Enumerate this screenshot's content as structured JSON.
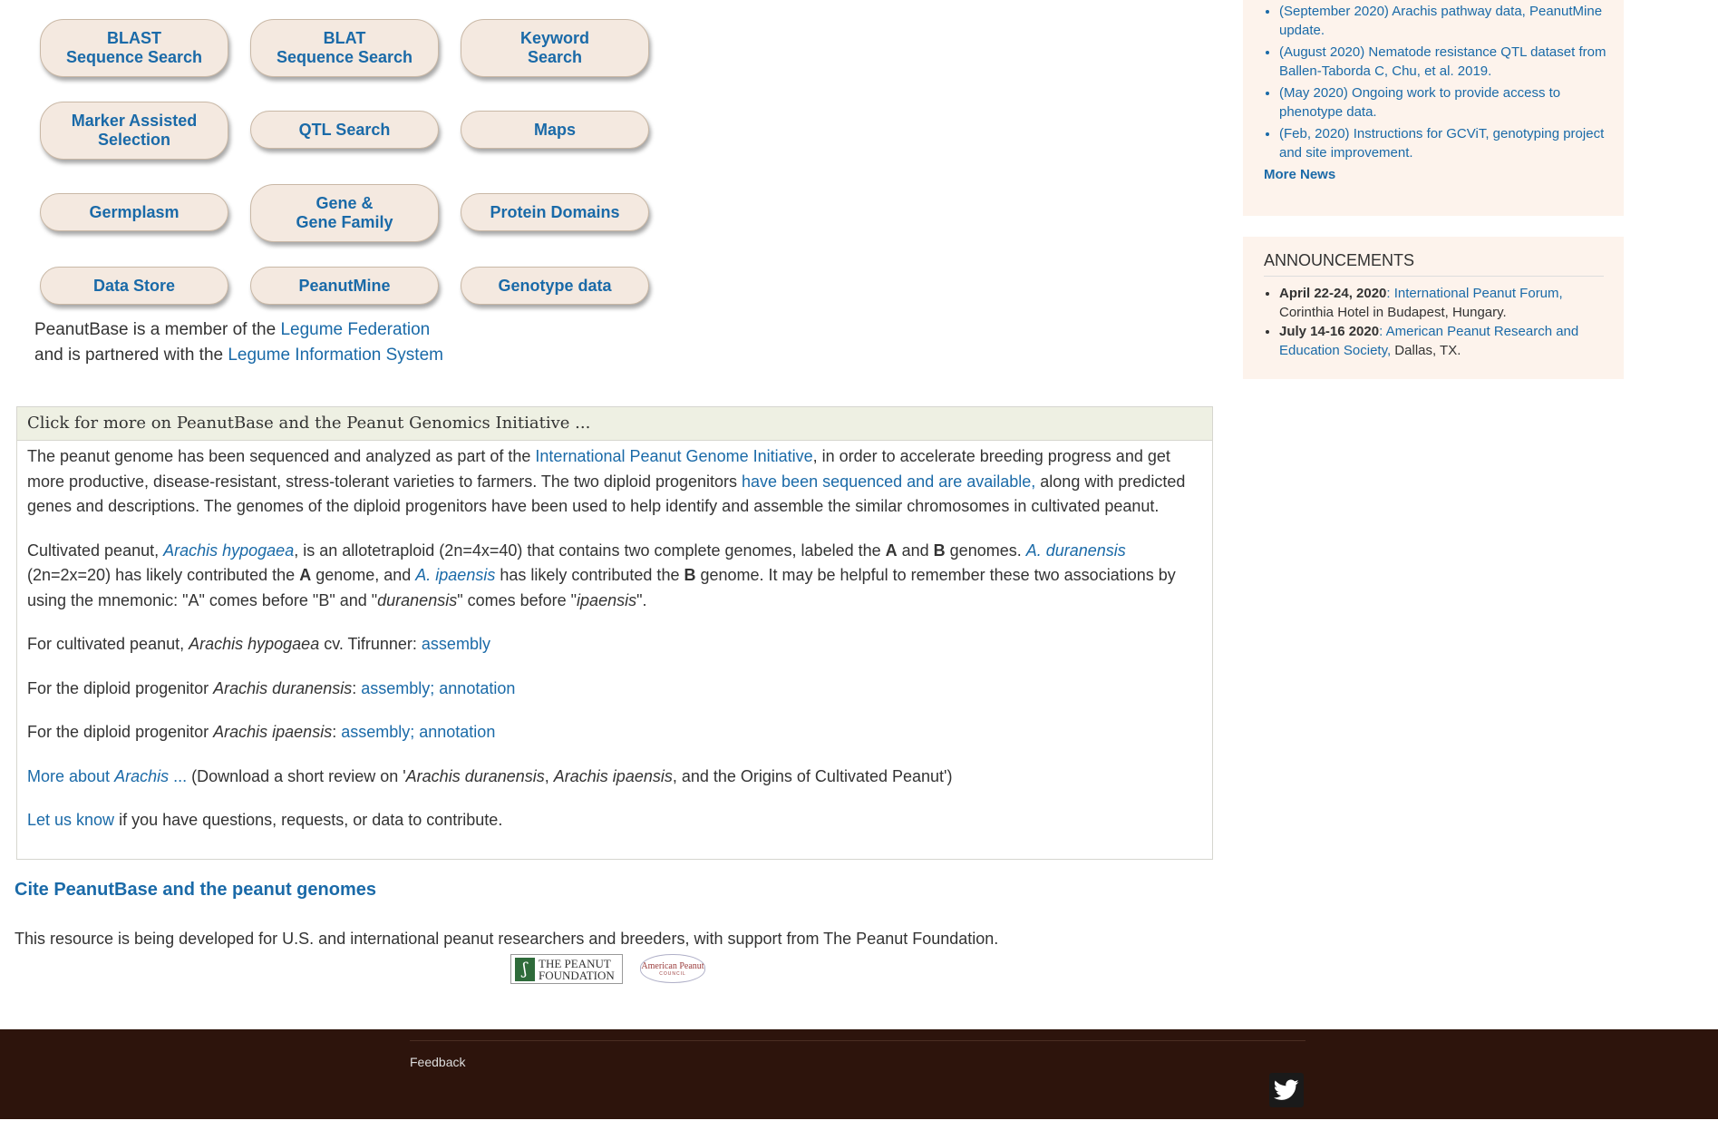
{
  "nav_buttons": [
    {
      "label": "BLAST\nSequence Search"
    },
    {
      "label": "BLAT\nSequence Search"
    },
    {
      "label": "Keyword\nSearch"
    },
    {
      "label": "Marker Assisted\nSelection"
    },
    {
      "label": "QTL Search"
    },
    {
      "label": "Maps"
    },
    {
      "label": "Germplasm"
    },
    {
      "label": "Gene &\nGene Family"
    },
    {
      "label": "Protein Domains"
    },
    {
      "label": "Data Store"
    },
    {
      "label": "PeanutMine"
    },
    {
      "label": "Genotype data"
    }
  ],
  "membership": {
    "line1_prefix": "PeanutBase is a member of the ",
    "line1_link": "Legume Federation",
    "line2_prefix": "and is partnered with the ",
    "line2_link": "Legume Information System"
  },
  "info_panel": {
    "heading": "Click for more on PeanutBase and the Peanut Genomics Initiative ...",
    "p1": {
      "t1": "The peanut genome has been sequenced and analyzed as part of the ",
      "link1": "International Peanut Genome Initiative",
      "t2": ", in order to accelerate breeding progress and get more productive, disease-resistant, stress-tolerant varieties to farmers. The two diploid progenitors ",
      "link2": "have been sequenced and are available,",
      "t3": " along with predicted genes and descriptions. The genomes of the diploid progenitors have been used to help identify and assemble the similar chromosomes in cultivated peanut."
    },
    "p2": {
      "t1": "Cultivated peanut, ",
      "link1": "Arachis hypogaea",
      "t2": ", is an allotetraploid (2n=4x=40) that contains two complete genomes, labeled the ",
      "b1": "A",
      "t3": " and ",
      "b2": "B",
      "t4": " genomes. ",
      "link2": "A. duranensis",
      "t5": " (2n=2x=20) has likely contributed the ",
      "b3": "A",
      "t6": " genome, and ",
      "link3": "A. ipaensis",
      "t7": " has likely contributed the ",
      "b4": "B",
      "t8": " genome. It may be helpful to remember these two associations by using the mnemonic: \"A\" comes before \"B\" and \"",
      "i1": "duranensis",
      "t9": "\" comes before \"",
      "i2": "ipaensis",
      "t10": "\"."
    },
    "p3": {
      "t1": "For cultivated peanut, ",
      "i1": "Arachis hypogaea",
      "t2": " cv. Tifrunner: ",
      "link1": "assembly"
    },
    "p4": {
      "t1": "For the diploid progenitor ",
      "i1": "Arachis duranensis",
      "t2": ": ",
      "link1": "assembly",
      "sep": ";",
      "link2": " annotation"
    },
    "p5": {
      "t1": "For the diploid progenitor ",
      "i1": "Arachis ipaensis",
      "t2": ": ",
      "link1": "assembly",
      "sep": ";",
      "link2": " annotation"
    },
    "p6": {
      "link_pre": "More about ",
      "link_i": "Arachis",
      "link_post": " ...",
      "t1": " (Download a short review on '",
      "i1": "Arachis duranensis",
      "t2": ", ",
      "i2": "Arachis ipaensis",
      "t3": ", and the Origins of Cultivated Peanut')"
    },
    "p7": {
      "link1": "Let us know",
      "t1": " if you have questions, requests, or data to contribute."
    }
  },
  "cite_link": "Cite PeanutBase and the peanut genomes",
  "support_text": "This resource is being developed for U.S. and international peanut researchers and breeders, with support from The Peanut Foundation.",
  "logos": {
    "peanut_foundation": "THE PEANUT\nFOUNDATION",
    "american_peanut": "American Peanut",
    "american_peanut_sub": "COUNCIL"
  },
  "news": {
    "items": [
      "(September 2020) Arachis pathway data, PeanutMine update.",
      "(August 2020) Nematode resistance QTL dataset from Ballen-Taborda C, Chu, et al. 2019.",
      "(May 2020) Ongoing work to provide access to phenotype data.",
      "(Feb, 2020) Instructions for GCViT, genotyping project and site improvement."
    ],
    "more": "More News"
  },
  "announcements": {
    "title": "ANNOUNCEMENTS",
    "items": [
      {
        "date": "April 22-24, 2020",
        "sep": ": ",
        "link": "International Peanut Forum,",
        "rest": " Corinthia Hotel in Budapest, Hungary."
      },
      {
        "date": "July 14-16 2020",
        "sep": ": ",
        "link": "American Peanut Research and Education Society,",
        "rest": " Dallas, TX."
      }
    ]
  },
  "footer": {
    "feedback": "Feedback"
  },
  "colors": {
    "link": "#1a6aa8",
    "button_bg": "#f4e9e0",
    "sidebar_bg": "#fdf3ec",
    "footer_bg": "#2d140c",
    "panel_head_bg": "#eef0e3"
  }
}
